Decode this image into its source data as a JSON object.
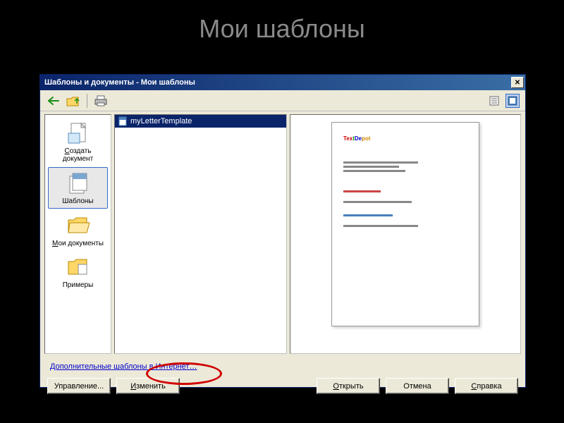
{
  "slide": {
    "title": "Мои шаблоны"
  },
  "dialog": {
    "title": "Шаблоны и документы - Мои шаблоны"
  },
  "sidebar": {
    "items": [
      {
        "label": "Создать документ",
        "accel_index": 0
      },
      {
        "label": "Шаблоны",
        "accel_index": -1
      },
      {
        "label": "Мои документы",
        "accel_index": 0
      },
      {
        "label": "Примеры",
        "accel_index": -1
      }
    ]
  },
  "list": {
    "items": [
      {
        "label": "myLetterTemplate",
        "selected": true
      }
    ]
  },
  "link": {
    "label": "Дополнительные шаблоны в Интернет…"
  },
  "buttons": {
    "manage": "Управление...",
    "edit": "Изменить",
    "open": "Открыть",
    "cancel": "Отмена",
    "help": "Справка"
  },
  "preview": {
    "logo_fragments": [
      "Tex",
      "t",
      "De",
      "pot"
    ]
  }
}
